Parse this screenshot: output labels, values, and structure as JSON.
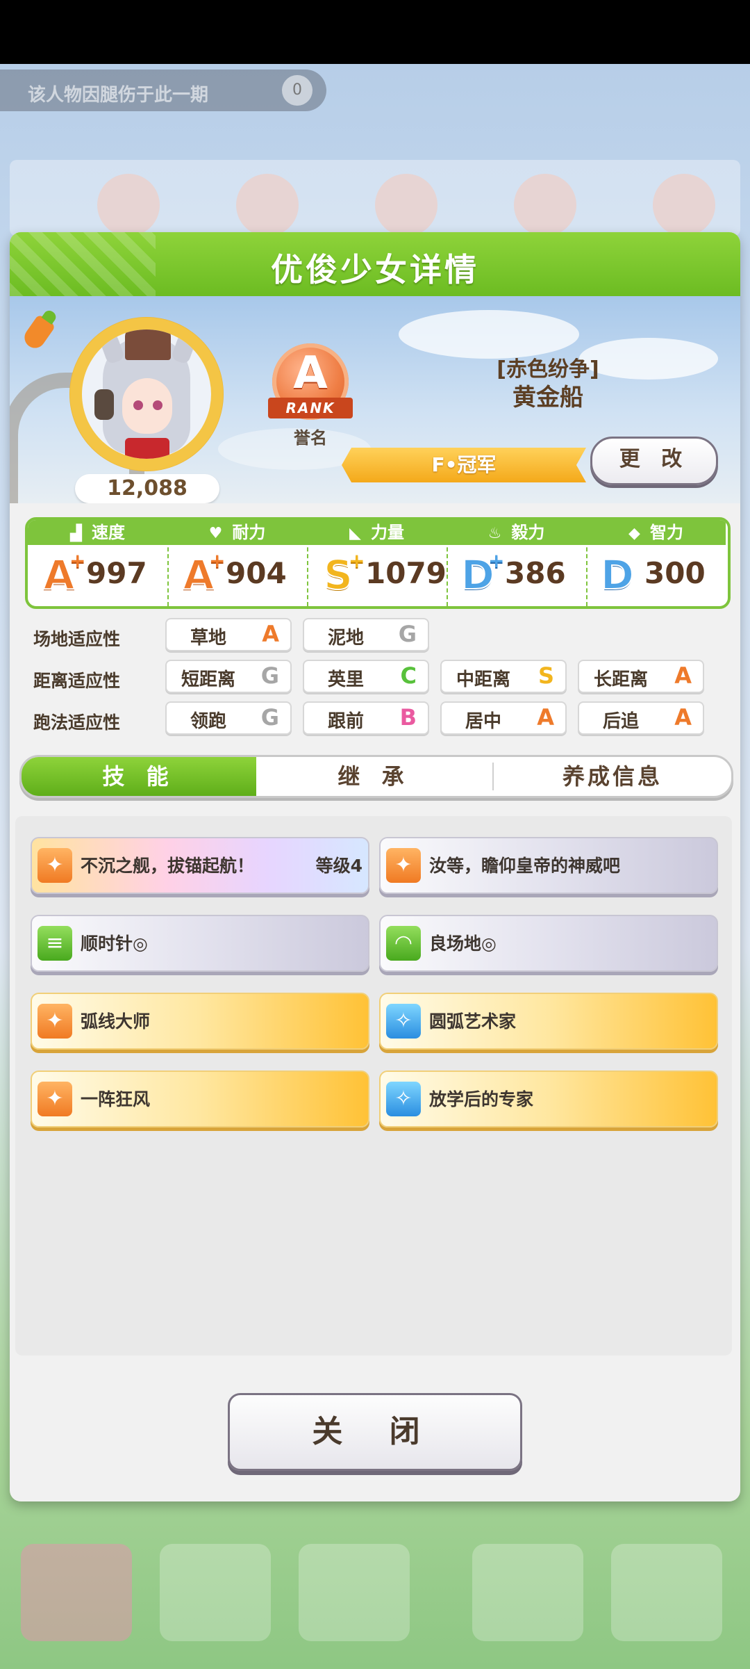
{
  "background": {
    "banner_text": "该人物因腿伤于此一期",
    "banner_number": "0"
  },
  "dialog": {
    "title": "优俊少女详情"
  },
  "profile": {
    "fans": "12,088",
    "rank_letter": "A",
    "rank_ribbon": "RANK",
    "rank_label": "誉名",
    "title_sub": "[赤色纷争]",
    "name": "黄金船",
    "rank_title": "F•冠军",
    "change_button": "更 改"
  },
  "stats": [
    {
      "label": "速度",
      "icon": "shoe-icon",
      "icon_glyph": "▟",
      "grade": "A",
      "plus": true,
      "value": "997"
    },
    {
      "label": "耐力",
      "icon": "heart-icon",
      "icon_glyph": "♥",
      "grade": "A",
      "plus": true,
      "value": "904"
    },
    {
      "label": "力量",
      "icon": "arm-icon",
      "icon_glyph": "◣",
      "grade": "S",
      "plus": true,
      "value": "1079"
    },
    {
      "label": "毅力",
      "icon": "flame-icon",
      "icon_glyph": "♨",
      "grade": "D",
      "plus": true,
      "value": "386"
    },
    {
      "label": "智力",
      "icon": "graduation-cap-icon",
      "icon_glyph": "◆",
      "grade": "D",
      "plus": false,
      "value": "300"
    }
  ],
  "aptitude": {
    "track": {
      "label": "场地适应性",
      "items": [
        {
          "name": "草地",
          "grade": "A"
        },
        {
          "name": "泥地",
          "grade": "G"
        }
      ]
    },
    "distance": {
      "label": "距离适应性",
      "items": [
        {
          "name": "短距离",
          "grade": "G"
        },
        {
          "name": "英里",
          "grade": "C"
        },
        {
          "name": "中距离",
          "grade": "S"
        },
        {
          "name": "长距离",
          "grade": "A"
        }
      ]
    },
    "style": {
      "label": "跑法适应性",
      "items": [
        {
          "name": "领跑",
          "grade": "G"
        },
        {
          "name": "跟前",
          "grade": "B"
        },
        {
          "name": "居中",
          "grade": "A"
        },
        {
          "name": "后追",
          "grade": "A"
        }
      ]
    }
  },
  "tabs": [
    {
      "label": "技 能",
      "active": true
    },
    {
      "label": "继 承",
      "active": false
    },
    {
      "label": "养成信息",
      "active": false
    }
  ],
  "skills": [
    {
      "name": "不沉之舰，拔锚起航！",
      "level": "等级4",
      "style": "rainbow",
      "icon": "running-figure-icon",
      "icon_color": "orange"
    },
    {
      "name": "汝等，瞻仰皇帝的神威吧",
      "level": "",
      "style": "white",
      "icon": "running-figure-icon",
      "icon_color": "orange"
    },
    {
      "name": "顺时针◎",
      "level": "",
      "style": "white",
      "icon": "track-flag-icon",
      "icon_color": "green"
    },
    {
      "name": "良场地◎",
      "level": "",
      "style": "white",
      "icon": "muscle-icon",
      "icon_color": "green"
    },
    {
      "name": "弧线大师",
      "level": "",
      "style": "gold",
      "icon": "running-figure-icon",
      "icon_color": "orange"
    },
    {
      "name": "圆弧艺术家",
      "level": "",
      "style": "gold",
      "icon": "sparkle-icon",
      "icon_color": "blue"
    },
    {
      "name": "一阵狂风",
      "level": "",
      "style": "gold",
      "icon": "running-figure-icon",
      "icon_color": "orange"
    },
    {
      "name": "放学后的专家",
      "level": "",
      "style": "gold",
      "icon": "sparkle-icon",
      "icon_color": "blue"
    }
  ],
  "close_button": "关 闭"
}
